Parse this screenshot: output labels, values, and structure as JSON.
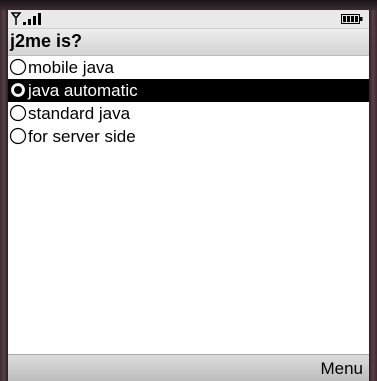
{
  "status_bar": {
    "signal_icon": "signal-strength-icon",
    "battery_icon": "battery-icon"
  },
  "title": "j2me is?",
  "choices": [
    {
      "label": "mobile java",
      "selected": false
    },
    {
      "label": "java automatic",
      "selected": true
    },
    {
      "label": "standard java",
      "selected": false
    },
    {
      "label": "for server side",
      "selected": false
    }
  ],
  "softkeys": {
    "right": "Menu"
  },
  "colors": {
    "highlight": "#000000",
    "highlight_text": "#ffffff",
    "bars": "#d4d4d4"
  }
}
